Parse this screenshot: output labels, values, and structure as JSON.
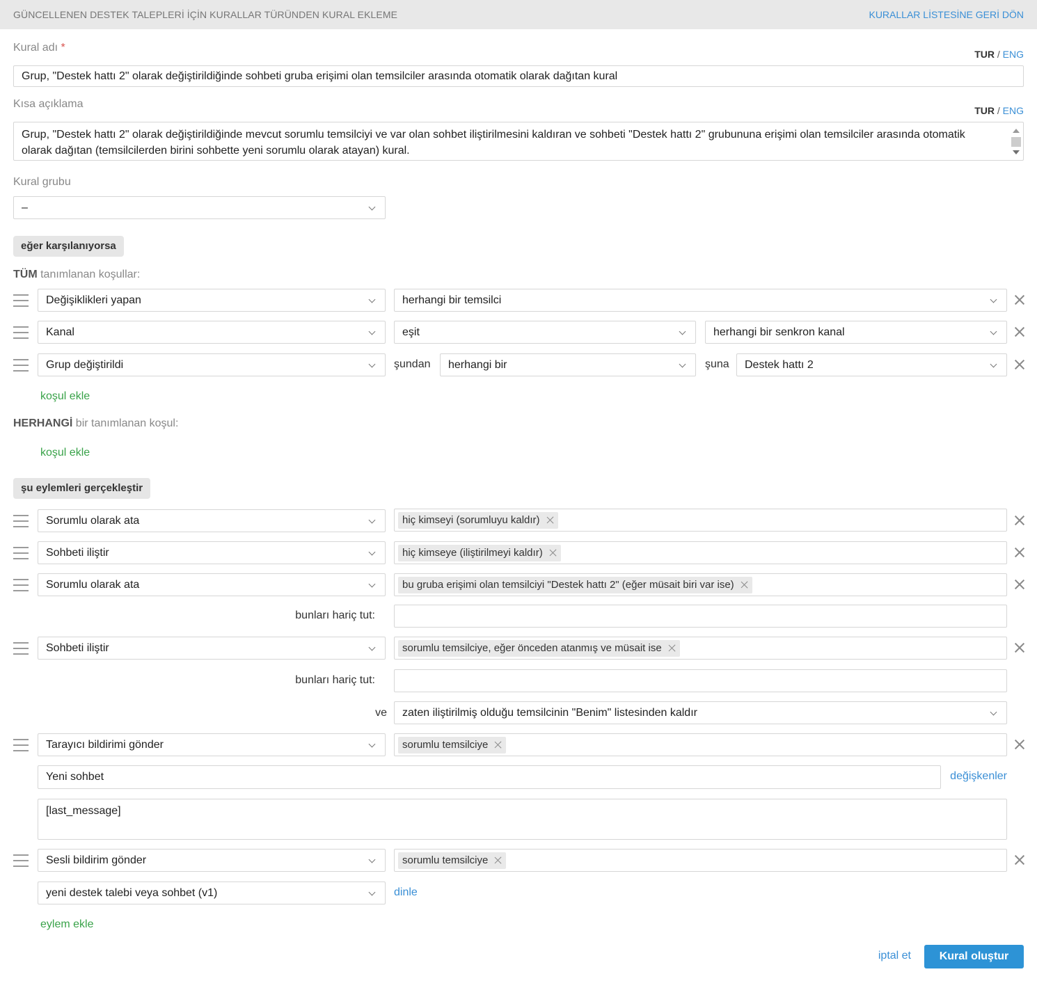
{
  "header": {
    "title": "GÜNCELLENEN DESTEK TALEPLERİ İÇİN KURALLAR TÜRÜNDEN KURAL EKLEME",
    "back_link": "KURALLAR LİSTESİNE GERİ DÖN"
  },
  "language": {
    "active": "TUR",
    "separator": "/",
    "other": "ENG"
  },
  "rule_name": {
    "label": "Kural adı",
    "required_mark": "*",
    "value": "Grup, \"Destek hattı 2\" olarak değiştirildiğinde sohbeti gruba erişimi olan temsilciler arasında otomatik olarak dağıtan kural"
  },
  "short_description": {
    "label": "Kısa açıklama",
    "value": "Grup, \"Destek hattı 2\" olarak değiştirildiğinde mevcut sorumlu temsilciyi ve var olan sohbet iliştirilmesini kaldıran ve sohbeti \"Destek hattı 2\" grubununa erişimi olan temsilciler arasında otomatik olarak dağıtan (temsilcilerden birini sohbette yeni sorumlu olarak atayan) kural."
  },
  "rule_group": {
    "label": "Kural grubu",
    "value": "–"
  },
  "conditions": {
    "section_label": "eğer karşılanıyorsa",
    "all": {
      "prefix": "TÜM",
      "suffix": "tanımlanan koşullar:",
      "rows": [
        {
          "field": "Değişiklikleri yapan",
          "value": "herhangi bir temsilci"
        },
        {
          "field": "Kanal",
          "operator": "eşit",
          "value": "herhangi bir senkron kanal"
        },
        {
          "field": "Grup değiştirildi",
          "from_label": "şundan",
          "from": "herhangi bir",
          "to_label": "şuna",
          "to": "Destek hattı 2"
        }
      ],
      "add_link": "koşul ekle"
    },
    "any": {
      "prefix": "HERHANGİ",
      "suffix": "bir tanımlanan koşul:",
      "add_link": "koşul ekle"
    }
  },
  "actions": {
    "section_label": "şu eylemleri gerçekleştir",
    "rows": [
      {
        "action": "Sorumlu olarak ata",
        "tag": "hiç kimseyi (sorumluyu kaldır)"
      },
      {
        "action": "Sohbeti iliştir",
        "tag": "hiç kimseye (iliştirilmeyi kaldır)"
      },
      {
        "action": "Sorumlu olarak ata",
        "tag": "bu gruba erişimi olan temsilciyi \"Destek hattı 2\" (eğer müsait biri var ise)",
        "exclude_label": "bunları hariç tut:"
      },
      {
        "action": "Sohbeti iliştir",
        "tag": "sorumlu temsilciye, eğer önceden atanmış ve müsait ise",
        "exclude_label": "bunları hariç tut:",
        "and_label": "ve",
        "and_value": "zaten iliştirilmiş olduğu temsilcinin \"Benim\" listesinden kaldır"
      },
      {
        "action": "Tarayıcı bildirimi gönder",
        "tag": "sorumlu temsilciye",
        "subject": "Yeni sohbet",
        "variables_link": "değişkenler",
        "body": "[last_message]"
      },
      {
        "action": "Sesli bildirim gönder",
        "tag": "sorumlu temsilciye",
        "sound": "yeni destek talebi veya sohbet (v1)",
        "listen_link": "dinle"
      }
    ],
    "add_link": "eylem ekle"
  },
  "footer": {
    "cancel": "iptal et",
    "submit": "Kural oluştur"
  },
  "colors": {
    "accent_blue": "#2d93d6",
    "link_green": "#3aa34a",
    "header_bg": "#e8e8e8"
  }
}
